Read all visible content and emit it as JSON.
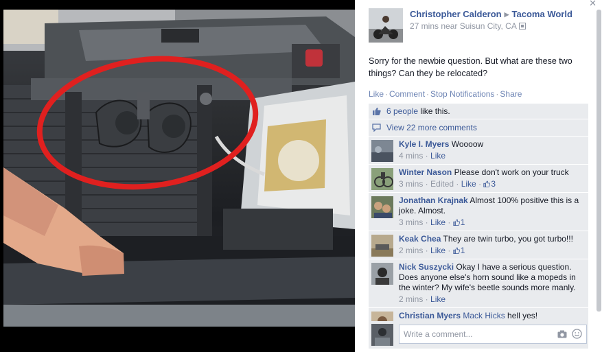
{
  "photo": {
    "description_icon": "car-engine-horns-photo"
  },
  "post": {
    "author": "Christopher Calderon",
    "target": "Tacoma World",
    "time": "27 mins near Suisun City, CA",
    "text": "Sorry for the newbie question. But what are these two things? Can they be relocated?",
    "actions": [
      "Like",
      "Comment",
      "Stop Notifications",
      "Share"
    ]
  },
  "likes": {
    "count_link": "6 people",
    "suffix": " like this."
  },
  "more_comments": "View 22 more comments",
  "comments": [
    {
      "name": "Kyle I. Myers",
      "text": "Woooow",
      "time": "4 mins",
      "like": "Like",
      "edited": "",
      "likes": ""
    },
    {
      "name": "Winter Nason",
      "text": "Please don't work on your truck",
      "time": "3 mins",
      "edited": "Edited",
      "like": "Like",
      "likes": "3"
    },
    {
      "name": "Jonathan Krajnak",
      "text": "Almost 100% positive this is a joke. Almost.",
      "time": "3 mins",
      "like": "Like",
      "edited": "",
      "likes": "1"
    },
    {
      "name": "Keak Chea",
      "text": "They are twin turbo, you got turbo!!!",
      "time": "2 mins",
      "like": "Like",
      "edited": "",
      "likes": "1"
    },
    {
      "name": "Nick Suszycki",
      "text": "Okay I have a serious question. Does anyone else's horn sound like a mopeds in the winter? My wife's beetle sounds more manly.",
      "time": "2 mins",
      "like": "Like",
      "edited": "",
      "likes": ""
    },
    {
      "name": "Christian Myers",
      "mention": "Mack Hicks",
      "text": " hell yes!",
      "time": "",
      "like": "",
      "edited": "",
      "likes": ""
    }
  ],
  "composer": {
    "placeholder": "Write a comment..."
  },
  "colors": {
    "link": "#3b5998",
    "ufi_bg": "#e9ebee",
    "meta": "#9197a3",
    "circle": "#e0201f"
  }
}
